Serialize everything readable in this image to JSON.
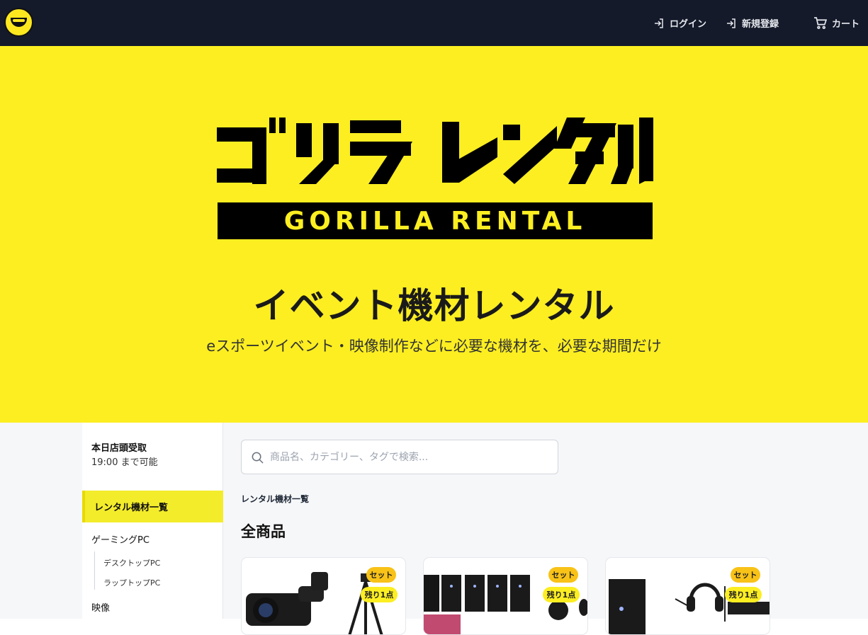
{
  "header": {
    "login_label": "ログイン",
    "register_label": "新規登録",
    "cart_label": "カート"
  },
  "hero": {
    "logo_jp": "ゴリラ レンタル",
    "logo_en": "GORILLA RENTAL",
    "title": "イベント機材レンタル",
    "subtitle": "eスポーツイベント・映像制作などに必要な機材を、必要な期間だけ"
  },
  "sidebar": {
    "pickup_title": "本日店頭受取",
    "pickup_note": "19:00 まで可能",
    "active_item": "レンタル機材一覧",
    "categories": [
      {
        "label": "ゲーミングPC",
        "children": [
          "デスクトップPC",
          "ラップトップPC"
        ]
      },
      {
        "label": "映像",
        "children": []
      }
    ]
  },
  "main": {
    "search_placeholder": "商品名、カテゴリー、タグで検索...",
    "breadcrumb": "レンタル機材一覧",
    "section_title": "全商品"
  },
  "products": [
    {
      "badge_set": "セット",
      "badge_stock": "残り1点",
      "icon": "camera-tripod-icon"
    },
    {
      "badge_set": "セット",
      "badge_stock": "残り1点",
      "icon": "gaming-pc-set-icon"
    },
    {
      "badge_set": "セット",
      "badge_stock": "残り1点",
      "icon": "pc-headset-set-icon"
    }
  ],
  "colors": {
    "header_bg": "#141a2a",
    "brand_yellow": "#fcee21",
    "badge_orange": "#f8c217"
  }
}
